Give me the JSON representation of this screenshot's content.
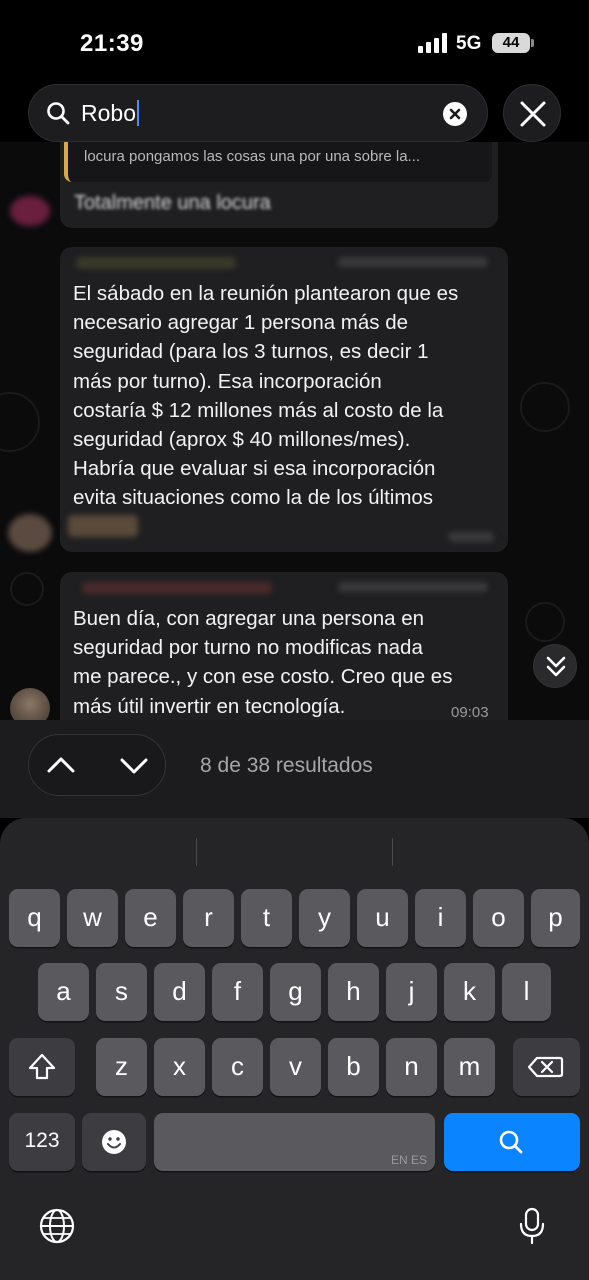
{
  "status_bar": {
    "time": "21:39",
    "network": "5G",
    "battery": "44"
  },
  "search": {
    "query": "Robo"
  },
  "messages": {
    "previous_quote": "locura pongamos las cosas una por una sobre la...",
    "previous_text": "Totalmente una locura",
    "message_1": {
      "lines": [
        "El sábado en la reunión plantearon que es",
        "necesario agregar 1 persona más de",
        "seguridad (para los 3 turnos, es decir 1",
        "más por turno). Esa incorporación",
        "costaría $ 12 millones más al costo de la",
        "seguridad (aprox $ 40 millones/mes).",
        "Habría que evaluar si esa incorporación",
        "evita situaciones como la de los últimos"
      ]
    },
    "message_2": {
      "lines": [
        "Buen día, con agregar una persona en",
        "seguridad por turno   no modificas nada",
        "me parece., y con ese costo. Creo que es",
        "más útil invertir en tecnología."
      ],
      "time": "09:03"
    }
  },
  "results": {
    "text": "8 de 38 resultados"
  },
  "keyboard": {
    "row1": [
      "q",
      "w",
      "e",
      "r",
      "t",
      "y",
      "u",
      "i",
      "o",
      "p"
    ],
    "row2": [
      "a",
      "s",
      "d",
      "f",
      "g",
      "h",
      "j",
      "k",
      "l"
    ],
    "row3": [
      "z",
      "x",
      "c",
      "v",
      "b",
      "n",
      "m"
    ],
    "numbers_label": "123",
    "space_lang": "EN ES"
  },
  "colors": {
    "accent": "#0a84ff",
    "quote_bar": "#d9a84a",
    "bubble": "#1f1f21"
  },
  "icons": [
    "search-icon",
    "clear-icon",
    "close-icon",
    "chevron-up-icon",
    "chevron-down-icon",
    "double-chevron-down-icon",
    "shift-icon",
    "delete-icon",
    "emoji-icon",
    "globe-icon",
    "microphone-icon"
  ]
}
